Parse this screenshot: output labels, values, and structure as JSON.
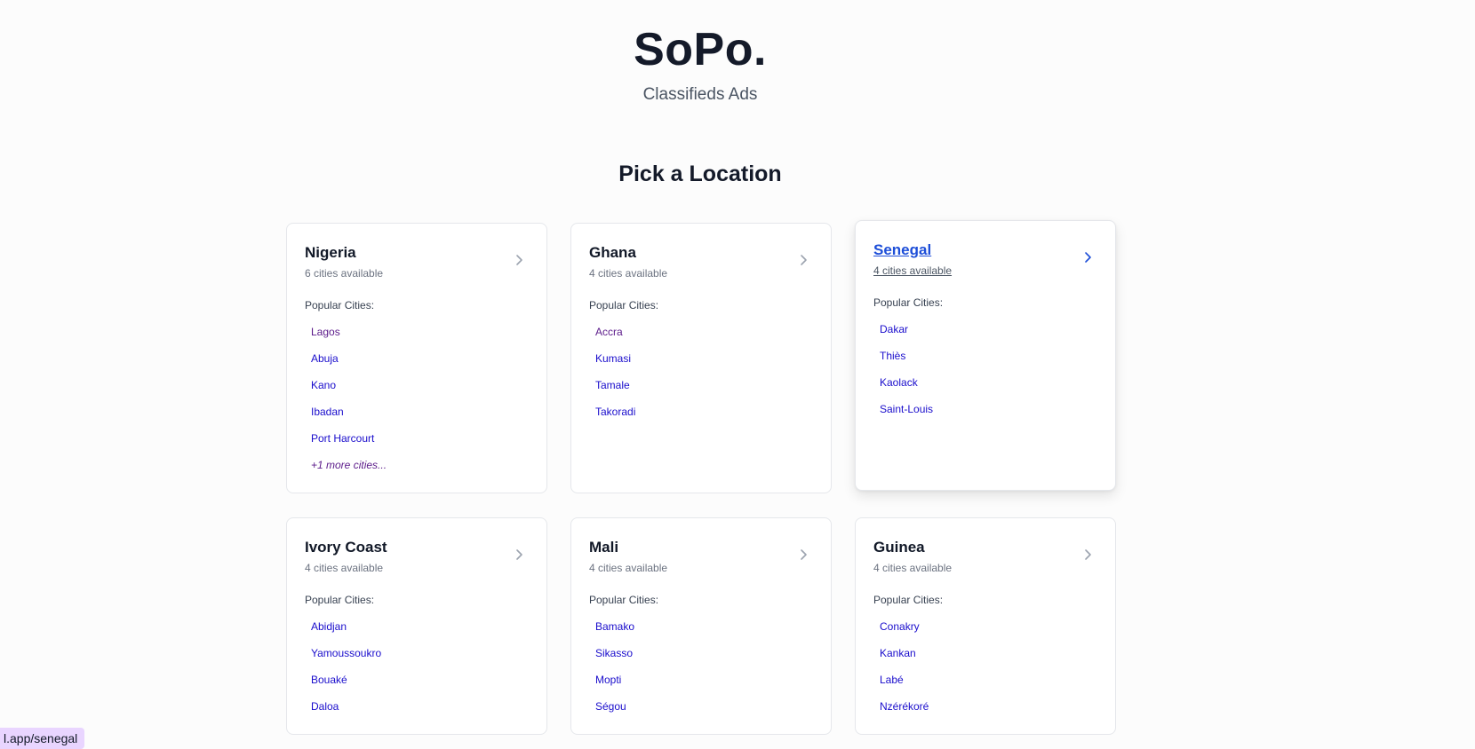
{
  "header": {
    "brand": "SoPo.",
    "tagline": "Classifieds Ads",
    "section_title": "Pick a Location"
  },
  "cards": [
    {
      "country": "Nigeria",
      "count": "6 cities available",
      "popular_label": "Popular Cities:",
      "cities": [
        "Lagos",
        "Abuja",
        "Kano",
        "Ibadan",
        "Port Harcourt"
      ],
      "more": "+1 more cities..."
    },
    {
      "country": "Ghana",
      "count": "4 cities available",
      "popular_label": "Popular Cities:",
      "cities": [
        "Accra",
        "Kumasi",
        "Tamale",
        "Takoradi"
      ]
    },
    {
      "country": "Senegal",
      "count": "4 cities available",
      "popular_label": "Popular Cities:",
      "cities": [
        "Dakar",
        "Thiès",
        "Kaolack",
        "Saint-Louis"
      ],
      "hovered": true
    },
    {
      "country": "Ivory Coast",
      "count": "4 cities available",
      "popular_label": "Popular Cities:",
      "cities": [
        "Abidjan",
        "Yamoussoukro",
        "Bouaké",
        "Daloa"
      ]
    },
    {
      "country": "Mali",
      "count": "4 cities available",
      "popular_label": "Popular Cities:",
      "cities": [
        "Bamako",
        "Sikasso",
        "Mopti",
        "Ségou"
      ]
    },
    {
      "country": "Guinea",
      "count": "4 cities available",
      "popular_label": "Popular Cities:",
      "cities": [
        "Conakry",
        "Kankan",
        "Labé",
        "Nzérékoré"
      ]
    }
  ],
  "status_url": "l.app/senegal",
  "colors": {
    "link": "#1a0dcc",
    "visited_link": "#5b1a8a",
    "hover_accent": "#1d4ed8",
    "chevron": "#9ca3af"
  }
}
